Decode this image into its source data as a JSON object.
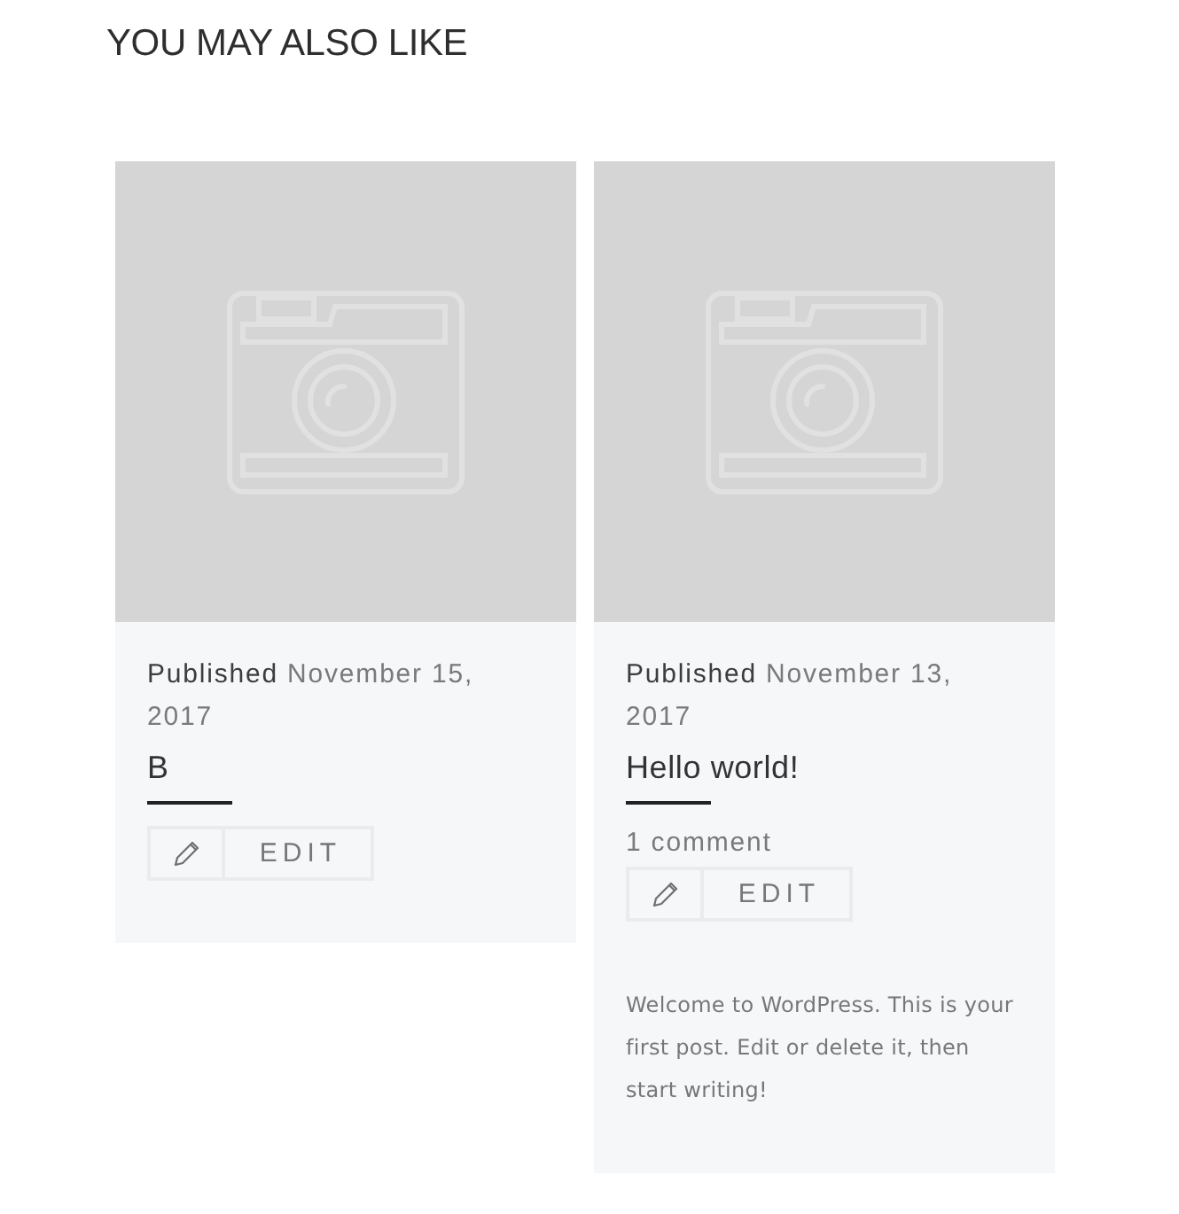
{
  "section": {
    "heading": "YOU MAY ALSO LIKE"
  },
  "posts": [
    {
      "published_label": "Published",
      "date": "November 15, 2017",
      "title": "B",
      "edit_label": "EDIT"
    },
    {
      "published_label": "Published",
      "date": "November 13, 2017",
      "title": "Hello world!",
      "comments": "1 comment",
      "edit_label": "EDIT",
      "excerpt": "Welcome to WordPress. This is your first post. Edit or delete it, then start writing!"
    }
  ]
}
